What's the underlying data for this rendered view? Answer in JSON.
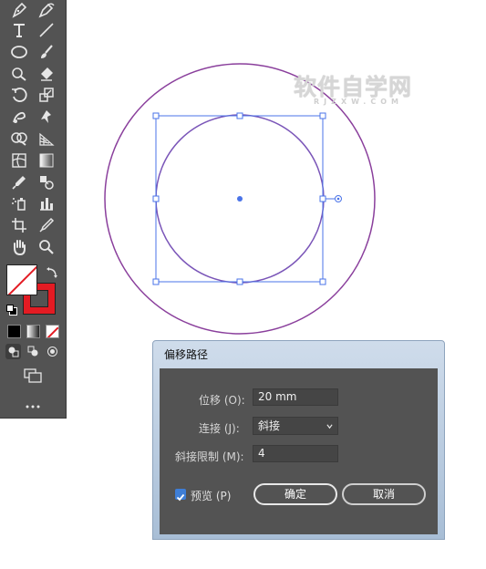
{
  "watermark": {
    "main": "软件自学网",
    "sub": "RJZXW.COM"
  },
  "dialog": {
    "title": "偏移路径",
    "offset_label": "位移 (O):",
    "offset_value": "20 mm",
    "joins_label": "连接 (J):",
    "joins_value": "斜接",
    "miter_label": "斜接限制 (M):",
    "miter_value": "4",
    "preview_label": "预览 (P)",
    "ok_label": "确定",
    "cancel_label": "取消"
  },
  "colors": {
    "toolbar_bg": "#535353",
    "selection_blue": "#4a73e8",
    "circle_purple": "#8a3f9c",
    "stroke_red": "#e31b23",
    "dialog_body": "#535353",
    "checkbox_blue": "#3e7ed6"
  },
  "toolbar": {
    "tools": [
      "pen-icon",
      "curvature-icon",
      "type-icon",
      "line-icon",
      "ellipse-icon",
      "paintbrush-icon",
      "shaper-icon",
      "eraser-icon",
      "rotate-icon",
      "scale-icon",
      "warp-icon",
      "puppet-warp-icon",
      "shape-builder-icon",
      "perspective-grid-icon",
      "mesh-icon",
      "gradient-icon",
      "eyedropper-icon",
      "blend-icon",
      "symbol-sprayer-icon",
      "column-graph-icon",
      "artboard-icon",
      "slice-icon",
      "hand-icon",
      "zoom-icon"
    ]
  }
}
